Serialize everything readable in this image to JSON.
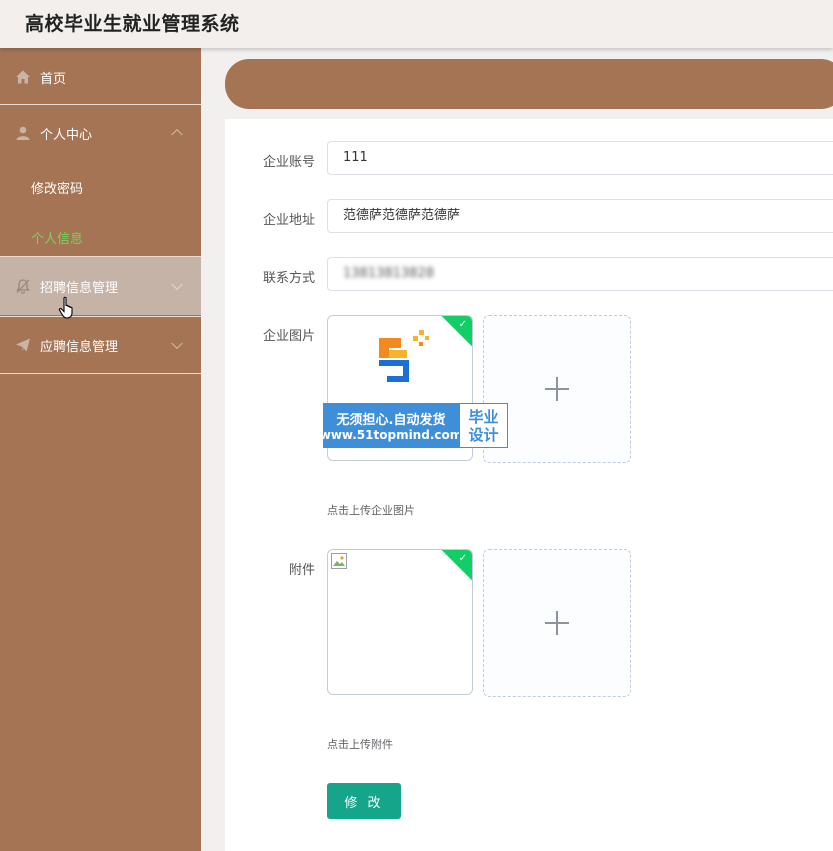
{
  "app": {
    "title": "高校毕业生就业管理系统"
  },
  "colors": {
    "sidebar": "#a57455",
    "active_sub": "#7cd35a",
    "primary_button": "#15a58a",
    "success_corner": "#13ce66"
  },
  "sidebar": {
    "items": [
      {
        "label": "首页",
        "icon": "home-icon"
      },
      {
        "label": "个人中心",
        "icon": "user-icon",
        "expanded": true,
        "children": [
          {
            "label": "修改密码"
          },
          {
            "label": "个人信息",
            "active": true
          }
        ]
      },
      {
        "label": "招聘信息管理",
        "icon": "bell-icon",
        "hovered": true
      },
      {
        "label": "应聘信息管理",
        "icon": "send-icon"
      }
    ]
  },
  "form": {
    "account": {
      "label": "企业账号",
      "value": "111"
    },
    "address": {
      "label": "企业地址",
      "value": "范德萨范德萨范德萨"
    },
    "contact": {
      "label": "联系方式",
      "value": "13813813828"
    },
    "image": {
      "label": "企业图片",
      "tip": "点击上传企业图片"
    },
    "attachment": {
      "label": "附件",
      "tip": "点击上传附件"
    },
    "submit_label": "修 改"
  },
  "watermark": {
    "line1": "无须担心.自动发货",
    "line2": "www.51topmind.com",
    "badge_line1": "毕业",
    "badge_line2": "设计"
  }
}
